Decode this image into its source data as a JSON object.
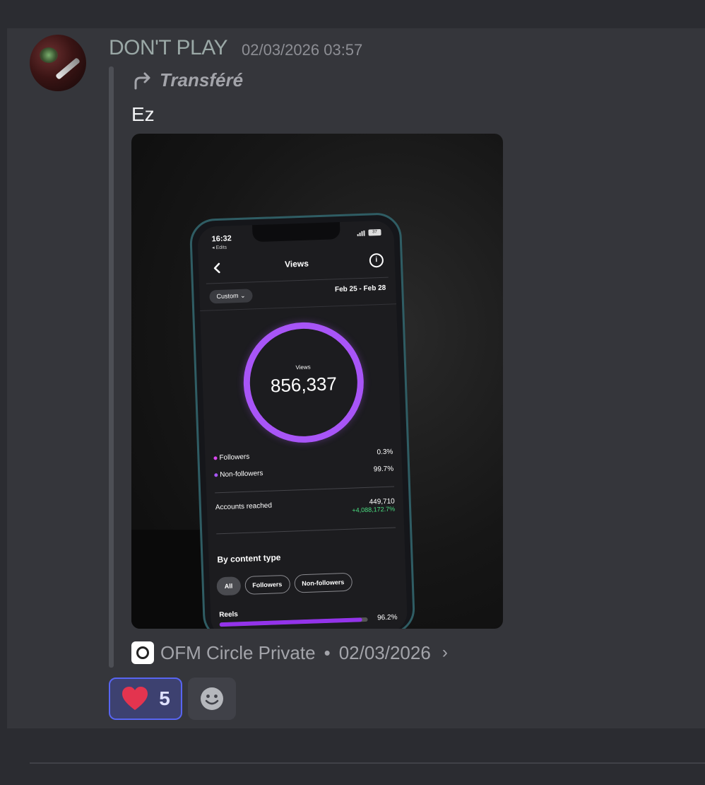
{
  "message": {
    "username": "DON'T PLAY",
    "timestamp": "02/03/2026 03:57",
    "forwarded_label": "Transféré",
    "text": "Ez",
    "source": {
      "name": "OFM Circle Private",
      "date": "02/03/2026",
      "separator": "•"
    },
    "reactions": [
      {
        "emoji": "heart",
        "count": "5"
      }
    ]
  },
  "photo": {
    "status_time": "16:32",
    "status_sub": "◂ Edits",
    "battery": "37",
    "screen_title": "Views",
    "filter": "Custom ⌄",
    "date_range": "Feb 25 - Feb 28",
    "ring_label": "Views",
    "total_views": "856,337",
    "followers_label": "Followers",
    "followers_pct": "0.3%",
    "nonfollowers_label": "Non-followers",
    "nonfollowers_pct": "99.7%",
    "accounts_reached_label": "Accounts reached",
    "accounts_reached": "449,710",
    "accounts_reached_delta": "+4,088,172.7%",
    "content_type_title": "By content type",
    "chips": [
      "All",
      "Followers",
      "Non-followers"
    ],
    "reels_label": "Reels",
    "reels_pct": "96.2%",
    "reels_fraction": 0.962
  },
  "colors": {
    "ring": "#a855f7",
    "followers_dot": "#d946ef",
    "nonfollowers_dot": "#a855f7",
    "delta": "#4ade80",
    "reaction_border": "#5865f2",
    "heart": "#e3344f"
  }
}
